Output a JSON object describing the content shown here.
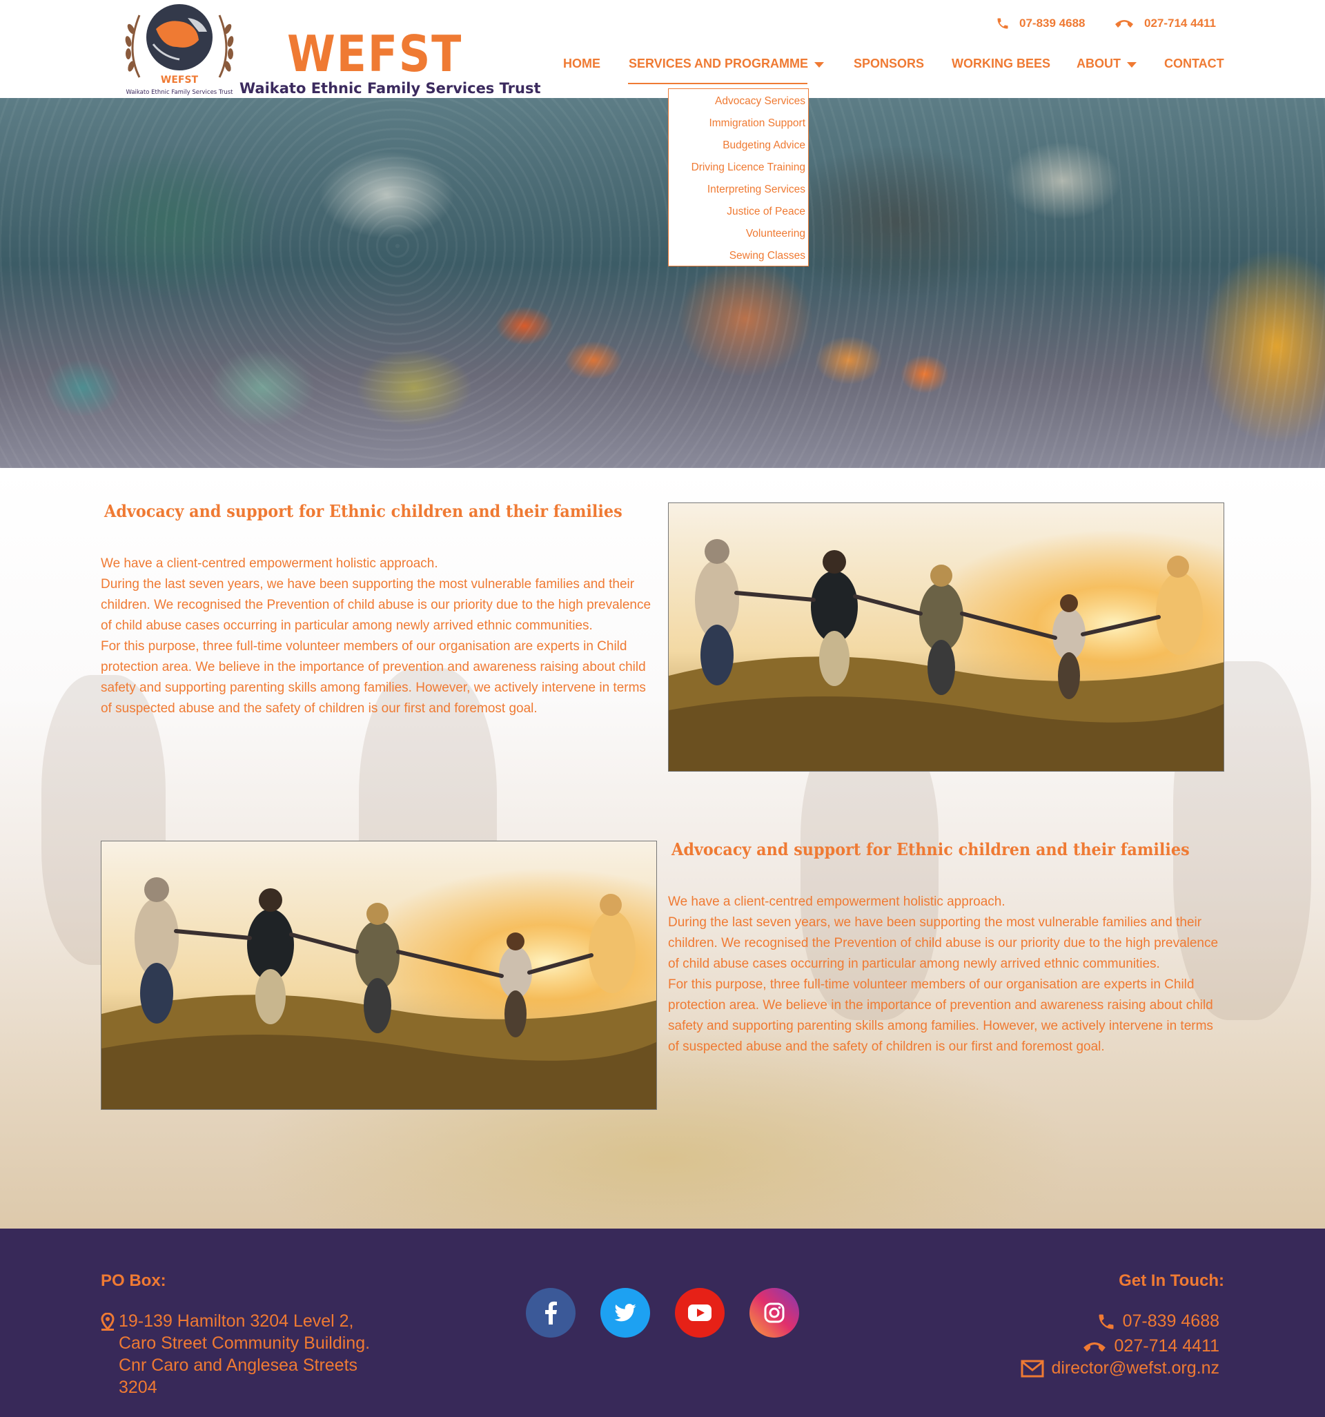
{
  "header": {
    "logo": {
      "emblem_text": "WEFST",
      "emblem_caption": "Waikato Ethnic Family Services Trust",
      "wordmark": "WEFST",
      "tagline": "Waikato Ethnic Family Services Trust"
    },
    "phone_landline": "07-839 4688",
    "phone_mobile": "027-714 4411",
    "nav": [
      {
        "label": "HOME",
        "has_dropdown": false
      },
      {
        "label": "SERVICES AND PROGRAMME",
        "has_dropdown": true,
        "active": true
      },
      {
        "label": "SPONSORS",
        "has_dropdown": false
      },
      {
        "label": "WORKING BEES",
        "has_dropdown": false
      },
      {
        "label": "ABOUT",
        "has_dropdown": true
      },
      {
        "label": "CONTACT",
        "has_dropdown": false
      }
    ],
    "dropdown_items": [
      "Advocacy Services",
      "Immigration Support",
      "Budgeting Advice",
      "Driving Licence Training",
      "Interpreting Services",
      "Justice of Peace",
      "Volunteering",
      "Sewing Classes"
    ]
  },
  "sections": [
    {
      "heading": "Advocacy and support for Ethnic children and their families",
      "paragraphs": [
        "We have a client-centred empowerment holistic approach.",
        "During the last seven years, we have been supporting the most vulnerable families and their children. We recognised the Prevention of child abuse is our priority due to the high prevalence of child abuse cases occurring in particular among newly arrived ethnic communities.",
        "For this purpose, three full-time volunteer members of our organisation are experts in Child protection area. We believe in the importance of prevention and awareness raising about child safety and supporting parenting skills among families. However, we actively intervene in terms of suspected abuse and the safety of children is our first and foremost goal."
      ]
    },
    {
      "heading": "Advocacy and support for Ethnic children and their families",
      "paragraphs": [
        "We have a client-centred empowerment holistic approach.",
        "During the last seven years, we have been supporting the most vulnerable families and their children. We recognised the Prevention of child abuse is our priority due to the high prevalence of child abuse cases occurring in particular among newly arrived ethnic communities.",
        "For this purpose, three full-time volunteer members of our organisation are experts in Child protection area. We believe in the importance of prevention and awareness raising about child safety and supporting parenting skills among families. However, we actively intervene in terms of suspected abuse and the safety of children is our first and foremost goal."
      ]
    }
  ],
  "footer": {
    "po_box_title": "PO Box:",
    "address": "19-139 Hamilton 3204 Level 2, Caro Street Community Building. Cnr Caro and Anglesea Streets 3204",
    "social": [
      {
        "name": "facebook",
        "icon": "facebook-icon",
        "color": "#3b5998"
      },
      {
        "name": "twitter",
        "icon": "twitter-icon",
        "color": "#1da1f2"
      },
      {
        "name": "youtube",
        "icon": "youtube-icon",
        "color": "#e62117"
      },
      {
        "name": "instagram",
        "icon": "instagram-icon",
        "color": "#c13584"
      }
    ],
    "get_in_touch_title": "Get In Touch:",
    "phone_landline": "07-839 4688",
    "phone_mobile": "027-714 4411",
    "email": "director@wefst.org.nz"
  },
  "colors": {
    "accent": "#ef7a33",
    "footer_bg": "#382959",
    "brand_dark": "#3b2a5e"
  }
}
